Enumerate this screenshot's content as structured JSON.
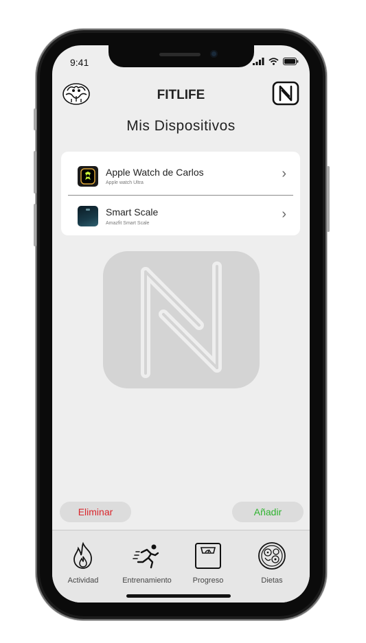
{
  "status_bar": {
    "time": "9:41"
  },
  "header": {
    "app_name": "FITLIFE",
    "page_title": "Mis Dispositivos"
  },
  "devices": [
    {
      "name": "Apple Watch de Carlos",
      "model": "Apple watch Ultra"
    },
    {
      "name": "Smart Scale",
      "model": "Amazfit Smart Scale"
    }
  ],
  "actions": {
    "remove_label": "Eliminar",
    "add_label": "Añadir"
  },
  "tabs": [
    {
      "label": "Actividad",
      "icon": "flame-icon"
    },
    {
      "label": "Entrenamiento",
      "icon": "running-icon"
    },
    {
      "label": "Progreso",
      "icon": "scale-icon"
    },
    {
      "label": "Dietas",
      "icon": "food-bowl-icon"
    }
  ],
  "colors": {
    "remove": "#d9252b",
    "add": "#2fb32f",
    "screen_bg": "#eeeeee"
  }
}
